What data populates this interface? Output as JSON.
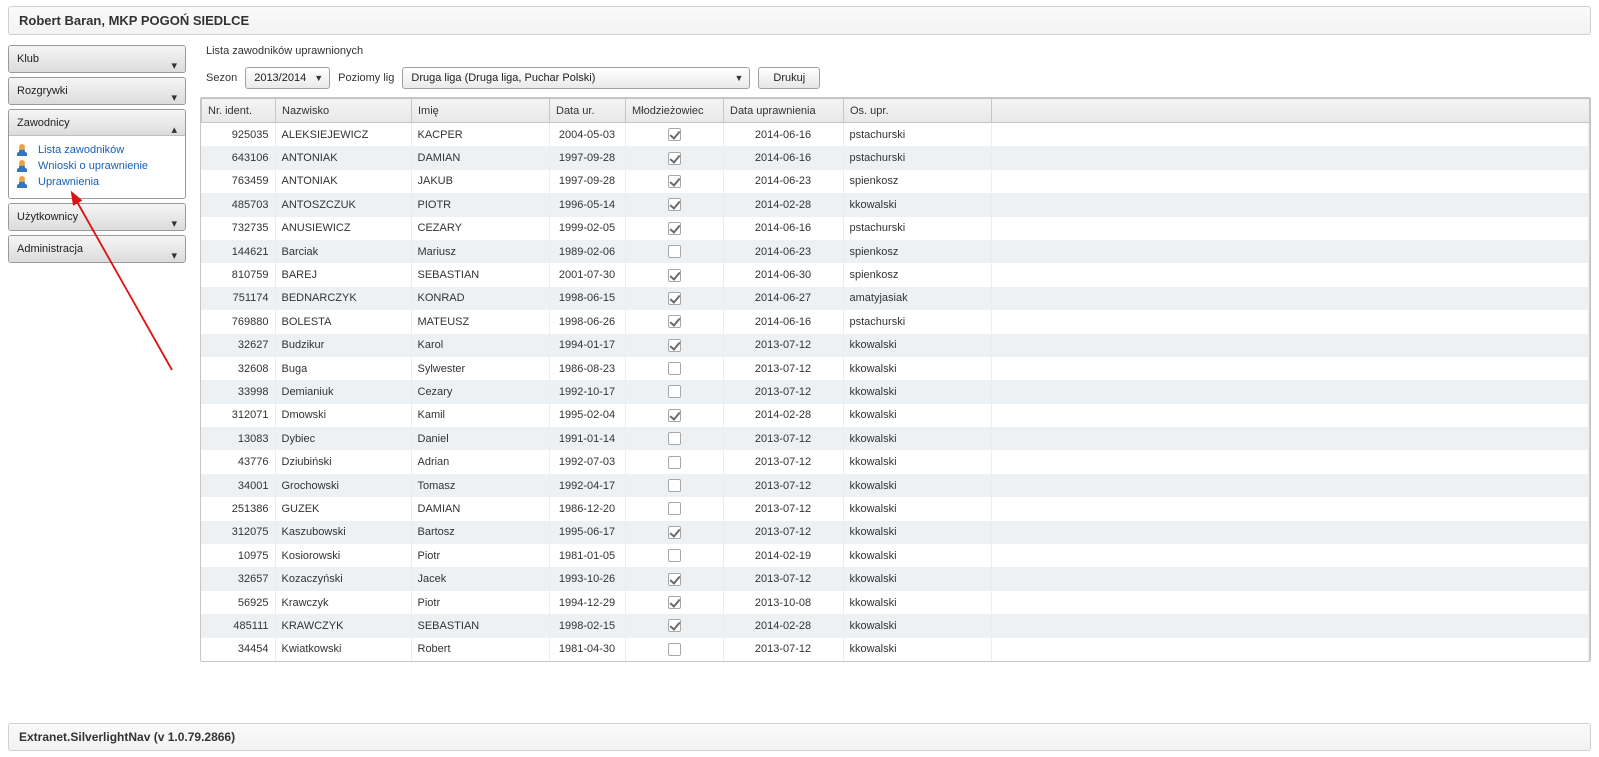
{
  "header": {
    "title": "Robert Baran, MKP POGOŃ SIEDLCE"
  },
  "footer": {
    "text": "Extranet.SilverlightNav (v 1.0.79.2866)"
  },
  "sidebar": {
    "sections": [
      {
        "label": "Klub",
        "open": false
      },
      {
        "label": "Rozgrywki",
        "open": false
      },
      {
        "label": "Zawodnicy",
        "open": true,
        "items": [
          {
            "label": "Lista zawodników"
          },
          {
            "label": "Wnioski o uprawnienie"
          },
          {
            "label": "Uprawnienia"
          }
        ]
      },
      {
        "label": "Użytkownicy",
        "open": false
      },
      {
        "label": "Administracja",
        "open": false
      }
    ]
  },
  "content": {
    "title": "Lista zawodników uprawnionych",
    "toolbar": {
      "season_label": "Sezon",
      "season_value": "2013/2014",
      "leagues_label": "Poziomy lig",
      "leagues_value": "Druga liga (Druga liga, Puchar Polski)",
      "print_label": "Drukuj"
    },
    "columns": {
      "id": "Nr. ident.",
      "surname": "Nazwisko",
      "name": "Imię",
      "dob": "Data ur.",
      "youth": "Młodzieżowiec",
      "auth_date": "Data uprawnienia",
      "auth_by": "Os. upr."
    },
    "rows": [
      {
        "id": "925035",
        "surname": "ALEKSIEJEWICZ",
        "name": "KACPER",
        "dob": "2004-05-03",
        "youth": true,
        "auth_date": "2014-06-16",
        "auth_by": "pstachurski"
      },
      {
        "id": "643106",
        "surname": "ANTONIAK",
        "name": "DAMIAN",
        "dob": "1997-09-28",
        "youth": true,
        "auth_date": "2014-06-16",
        "auth_by": "pstachurski"
      },
      {
        "id": "763459",
        "surname": "ANTONIAK",
        "name": "JAKUB",
        "dob": "1997-09-28",
        "youth": true,
        "auth_date": "2014-06-23",
        "auth_by": "spienkosz"
      },
      {
        "id": "485703",
        "surname": "ANTOSZCZUK",
        "name": "PIOTR",
        "dob": "1996-05-14",
        "youth": true,
        "auth_date": "2014-02-28",
        "auth_by": "kkowalski"
      },
      {
        "id": "732735",
        "surname": "ANUSIEWICZ",
        "name": "CEZARY",
        "dob": "1999-02-05",
        "youth": true,
        "auth_date": "2014-06-16",
        "auth_by": "pstachurski"
      },
      {
        "id": "144621",
        "surname": "Barciak",
        "name": "Mariusz",
        "dob": "1989-02-06",
        "youth": false,
        "auth_date": "2014-06-23",
        "auth_by": "spienkosz"
      },
      {
        "id": "810759",
        "surname": "BAREJ",
        "name": "SEBASTIAN",
        "dob": "2001-07-30",
        "youth": true,
        "auth_date": "2014-06-30",
        "auth_by": "spienkosz"
      },
      {
        "id": "751174",
        "surname": "BEDNARCZYK",
        "name": "KONRAD",
        "dob": "1998-06-15",
        "youth": true,
        "auth_date": "2014-06-27",
        "auth_by": "amatyjasiak"
      },
      {
        "id": "769880",
        "surname": "BOLESTA",
        "name": "MATEUSZ",
        "dob": "1998-06-26",
        "youth": true,
        "auth_date": "2014-06-16",
        "auth_by": "pstachurski"
      },
      {
        "id": "32627",
        "surname": "Budzikur",
        "name": "Karol",
        "dob": "1994-01-17",
        "youth": true,
        "auth_date": "2013-07-12",
        "auth_by": "kkowalski"
      },
      {
        "id": "32608",
        "surname": "Buga",
        "name": "Sylwester",
        "dob": "1986-08-23",
        "youth": false,
        "auth_date": "2013-07-12",
        "auth_by": "kkowalski"
      },
      {
        "id": "33998",
        "surname": "Demianiuk",
        "name": "Cezary",
        "dob": "1992-10-17",
        "youth": false,
        "auth_date": "2013-07-12",
        "auth_by": "kkowalski"
      },
      {
        "id": "312071",
        "surname": "Dmowski",
        "name": "Kamil",
        "dob": "1995-02-04",
        "youth": true,
        "auth_date": "2014-02-28",
        "auth_by": "kkowalski"
      },
      {
        "id": "13083",
        "surname": "Dybiec",
        "name": "Daniel",
        "dob": "1991-01-14",
        "youth": false,
        "auth_date": "2013-07-12",
        "auth_by": "kkowalski"
      },
      {
        "id": "43776",
        "surname": "Dziubiński",
        "name": "Adrian",
        "dob": "1992-07-03",
        "youth": false,
        "auth_date": "2013-07-12",
        "auth_by": "kkowalski"
      },
      {
        "id": "34001",
        "surname": "Grochowski",
        "name": "Tomasz",
        "dob": "1992-04-17",
        "youth": false,
        "auth_date": "2013-07-12",
        "auth_by": "kkowalski"
      },
      {
        "id": "251386",
        "surname": "GUZEK",
        "name": "DAMIAN",
        "dob": "1986-12-20",
        "youth": false,
        "auth_date": "2013-07-12",
        "auth_by": "kkowalski"
      },
      {
        "id": "312075",
        "surname": "Kaszubowski",
        "name": "Bartosz",
        "dob": "1995-06-17",
        "youth": true,
        "auth_date": "2013-07-12",
        "auth_by": "kkowalski"
      },
      {
        "id": "10975",
        "surname": "Kosiorowski",
        "name": "Piotr",
        "dob": "1981-01-05",
        "youth": false,
        "auth_date": "2014-02-19",
        "auth_by": "kkowalski"
      },
      {
        "id": "32657",
        "surname": "Kozaczyński",
        "name": "Jacek",
        "dob": "1993-10-26",
        "youth": true,
        "auth_date": "2013-07-12",
        "auth_by": "kkowalski"
      },
      {
        "id": "56925",
        "surname": "Krawczyk",
        "name": "Piotr",
        "dob": "1994-12-29",
        "youth": true,
        "auth_date": "2013-10-08",
        "auth_by": "kkowalski"
      },
      {
        "id": "485111",
        "surname": "KRAWCZYK",
        "name": "SEBASTIAN",
        "dob": "1998-02-15",
        "youth": true,
        "auth_date": "2014-02-28",
        "auth_by": "kkowalski"
      },
      {
        "id": "34454",
        "surname": "Kwiatkowski",
        "name": "Robert",
        "dob": "1981-04-30",
        "youth": false,
        "auth_date": "2013-07-12",
        "auth_by": "kkowalski"
      }
    ]
  }
}
